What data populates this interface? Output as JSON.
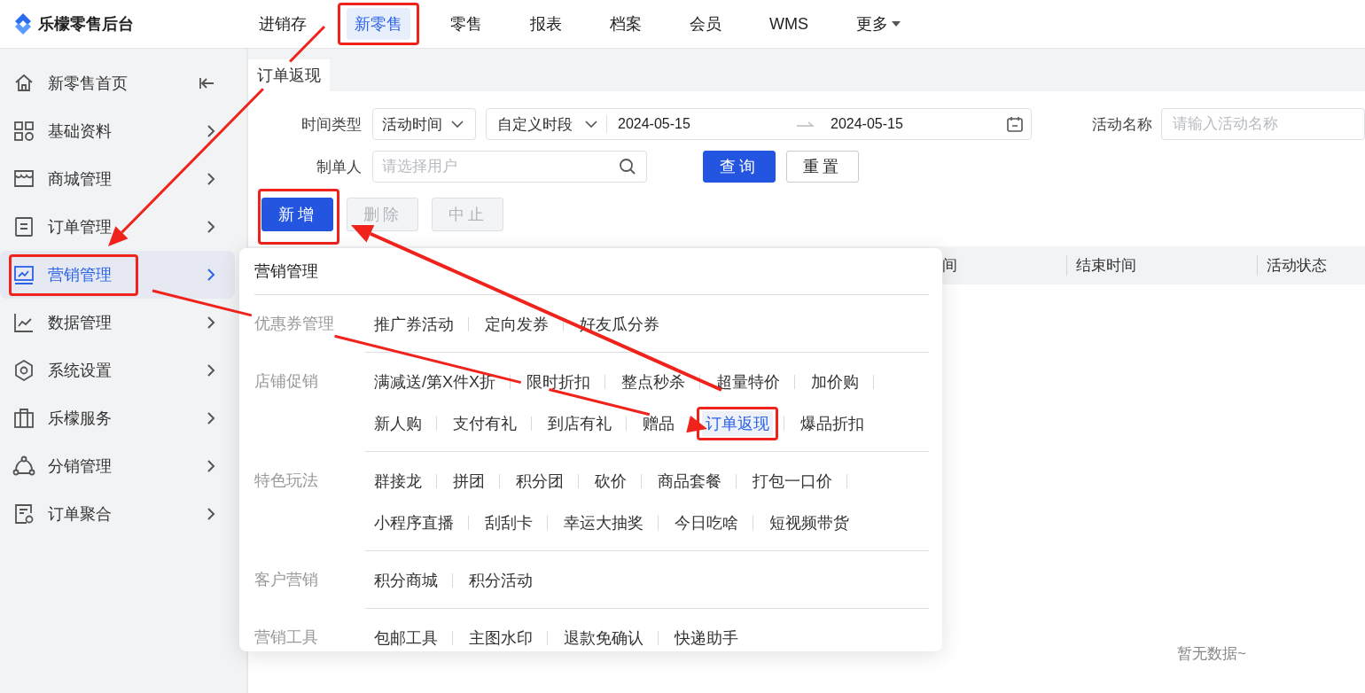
{
  "app": {
    "title": "乐檬零售后台"
  },
  "top_nav": [
    {
      "label": "进销存",
      "kind": "link",
      "selected": false,
      "annotated": false
    },
    {
      "label": "新零售",
      "kind": "link",
      "selected": true,
      "annotated": true
    },
    {
      "label": "零售",
      "kind": "link",
      "selected": false,
      "annotated": false
    },
    {
      "label": "报表",
      "kind": "link",
      "selected": false,
      "annotated": false
    },
    {
      "label": "档案",
      "kind": "link",
      "selected": false,
      "annotated": false
    },
    {
      "label": "会员",
      "kind": "link",
      "selected": false,
      "annotated": false
    },
    {
      "label": "WMS",
      "kind": "link",
      "selected": false,
      "annotated": false
    },
    {
      "label": "更多",
      "kind": "menu",
      "selected": false,
      "annotated": false
    }
  ],
  "sidebar": {
    "items": [
      {
        "label": "新零售首页",
        "kind": "page",
        "selected": false,
        "annotated": false
      },
      {
        "label": "基础资料",
        "kind": "group",
        "selected": false,
        "annotated": false
      },
      {
        "label": "商城管理",
        "kind": "group",
        "selected": false,
        "annotated": false
      },
      {
        "label": "订单管理",
        "kind": "group",
        "selected": false,
        "annotated": false
      },
      {
        "label": "营销管理",
        "kind": "group",
        "selected": true,
        "annotated": true
      },
      {
        "label": "数据管理",
        "kind": "group",
        "selected": false,
        "annotated": false
      },
      {
        "label": "系统设置",
        "kind": "group",
        "selected": false,
        "annotated": false
      },
      {
        "label": "乐檬服务",
        "kind": "group",
        "selected": false,
        "annotated": false
      },
      {
        "label": "分销管理",
        "kind": "group",
        "selected": false,
        "annotated": false
      },
      {
        "label": "订单聚合",
        "kind": "group",
        "selected": false,
        "annotated": false
      }
    ]
  },
  "tabs": [
    {
      "label": "订单返现",
      "selected": true
    }
  ],
  "filters": {
    "time_type": {
      "label": "时间类型",
      "value": "活动时间"
    },
    "date_range": {
      "mode": "自定义时段",
      "start": "2024-05-15",
      "end": "2024-05-15"
    },
    "activity_name": {
      "label": "活动名称",
      "placeholder": "请输入活动名称"
    },
    "creator": {
      "label": "制单人",
      "placeholder": "请选择用户"
    },
    "buttons": [
      {
        "label": "查询",
        "kind": "primary"
      },
      {
        "label": "重置",
        "kind": "default"
      }
    ]
  },
  "actions": [
    {
      "label": "新增",
      "disabled": false,
      "annotated": true
    },
    {
      "label": "删除",
      "disabled": true,
      "annotated": false
    },
    {
      "label": "中止",
      "disabled": true,
      "annotated": false
    }
  ],
  "table": {
    "columns": [
      "间",
      "结束时间",
      "活动状态"
    ],
    "empty_text": "暂无数据~"
  },
  "flyout": {
    "title": "营销管理",
    "groups": [
      {
        "label": "优惠券管理",
        "items": [
          {
            "label": "推广券活动",
            "selected": false,
            "annotated": false
          },
          {
            "label": "定向发券",
            "selected": false,
            "annotated": false
          },
          {
            "label": "好友瓜分券",
            "selected": false,
            "annotated": false
          }
        ]
      },
      {
        "label": "店铺促销",
        "items": [
          {
            "label": "满减送/第X件X折",
            "selected": false,
            "annotated": false
          },
          {
            "label": "限时折扣",
            "selected": false,
            "annotated": false
          },
          {
            "label": "整点秒杀",
            "selected": false,
            "annotated": false
          },
          {
            "label": "超量特价",
            "selected": false,
            "annotated": false
          },
          {
            "label": "加价购",
            "selected": false,
            "annotated": false
          },
          {
            "label": "新人购",
            "selected": false,
            "annotated": false
          },
          {
            "label": "支付有礼",
            "selected": false,
            "annotated": false
          },
          {
            "label": "到店有礼",
            "selected": false,
            "annotated": false
          },
          {
            "label": "赠品",
            "selected": false,
            "annotated": false
          },
          {
            "label": "订单返现",
            "selected": true,
            "annotated": true
          },
          {
            "label": "爆品折扣",
            "selected": false,
            "annotated": false
          }
        ]
      },
      {
        "label": "特色玩法",
        "items": [
          {
            "label": "群接龙",
            "selected": false,
            "annotated": false
          },
          {
            "label": "拼团",
            "selected": false,
            "annotated": false
          },
          {
            "label": "积分团",
            "selected": false,
            "annotated": false
          },
          {
            "label": "砍价",
            "selected": false,
            "annotated": false
          },
          {
            "label": "商品套餐",
            "selected": false,
            "annotated": false
          },
          {
            "label": "打包一口价",
            "selected": false,
            "annotated": false
          },
          {
            "label": "小程序直播",
            "selected": false,
            "annotated": false
          },
          {
            "label": "刮刮卡",
            "selected": false,
            "annotated": false
          },
          {
            "label": "幸运大抽奖",
            "selected": false,
            "annotated": false
          },
          {
            "label": "今日吃啥",
            "selected": false,
            "annotated": false
          },
          {
            "label": "短视频带货",
            "selected": false,
            "annotated": false
          }
        ]
      },
      {
        "label": "客户营销",
        "items": [
          {
            "label": "积分商城",
            "selected": false,
            "annotated": false
          },
          {
            "label": "积分活动",
            "selected": false,
            "annotated": false
          }
        ]
      },
      {
        "label": "营销工具",
        "items": [
          {
            "label": "包邮工具",
            "selected": false,
            "annotated": false
          },
          {
            "label": "主图水印",
            "selected": false,
            "annotated": false
          },
          {
            "label": "退款免确认",
            "selected": false,
            "annotated": false
          },
          {
            "label": "快递助手",
            "selected": false,
            "annotated": false
          }
        ]
      }
    ]
  }
}
